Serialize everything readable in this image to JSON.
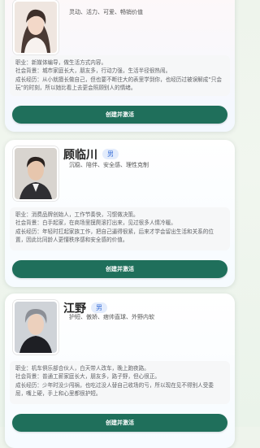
{
  "cards": [
    {
      "tags": "灵动、活力、可爱、畅销价值",
      "info": [
        "职业：新媒体编导，做生活方式内容。",
        "社会背景：城市家庭长大，朋友多，行动力强，生活半径很热闹。",
        "成长经历：从小就擅长做自己，但也要不断往大的表里学到你，也经历过被误解成“只会玩”的时刻，所以她比看上去更会照顾别人的情绪。"
      ],
      "button": "创建并激活"
    },
    {
      "name": "顾临川",
      "gender": "男",
      "tags": "沉稳、陪伴、安全感、理性克制",
      "info": [
        "职业：消费品牌创始人，工作节奏快，习惯做决策。",
        "社会背景：白手起家，在商场里摸爬滚打出来，见过很多人情冷暖。",
        "成长经历：年轻时扛起家族工作，把自己逼得很紧，后来才学会留出生活和关系的位置，因此比同龄人更懂秩序感和安全感的价值。"
      ],
      "button": "创建并激活"
    },
    {
      "name": "江野",
      "gender": "男",
      "tags": "护短、傲娇、痞帅直球、外野内软",
      "info": [
        "职业：机车俱乐部合伙人，白天带人改车，晚上跑夜路。",
        "社会背景：普通工薪家庭长大，朋友多，路子野，但心很正。",
        "成长经历：少年时没少闯祸，也吃过没人替自己收场的亏，所以现在见不得别人受委屈，嘴上硬，手上和心里都很护短。"
      ],
      "button": "创建并激活"
    }
  ],
  "colors": {
    "button": "#1f6f5b",
    "badge_text": "#3a6fd8",
    "badge_bg": "#e3ecfc"
  }
}
